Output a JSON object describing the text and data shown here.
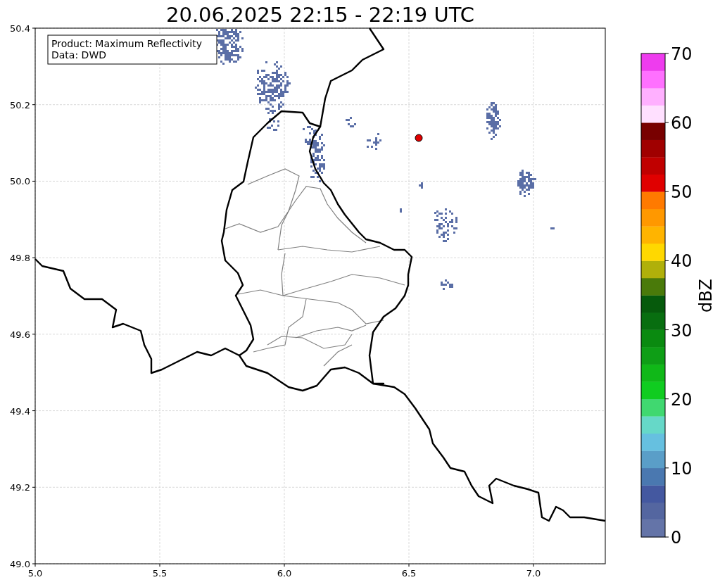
{
  "title": "20.06.2025 22:15 - 22:19 UTC",
  "info_box": [
    "Product: Maximum Reflectivity",
    "Data: DWD"
  ],
  "x_axis": {
    "ticks": [
      "5.0",
      "5.5",
      "6.0",
      "6.5",
      "7.0"
    ]
  },
  "y_axis": {
    "ticks": [
      "50.4",
      "50.2",
      "50.0",
      "49.8",
      "49.6",
      "49.4",
      "49.2",
      "49.0"
    ]
  },
  "colorbar": {
    "label": "dBZ",
    "ticks": [
      "70",
      "60",
      "50",
      "40",
      "30",
      "20",
      "10",
      "0"
    ],
    "bands": [
      {
        "color": "#6474a8"
      },
      {
        "color": "#5466a0"
      },
      {
        "color": "#4458a0"
      },
      {
        "color": "#4a78b0"
      },
      {
        "color": "#5a9ec8"
      },
      {
        "color": "#66c0e0"
      },
      {
        "color": "#66d8c8"
      },
      {
        "color": "#40d870"
      },
      {
        "color": "#10cc20"
      },
      {
        "color": "#10b818"
      },
      {
        "color": "#0e9e16"
      },
      {
        "color": "#0a8a10"
      },
      {
        "color": "#086e10"
      },
      {
        "color": "#065a0c"
      },
      {
        "color": "#4a7a0a"
      },
      {
        "color": "#b0b00a"
      },
      {
        "color": "#ffd800"
      },
      {
        "color": "#ffb400"
      },
      {
        "color": "#ff9800"
      },
      {
        "color": "#ff7a00"
      },
      {
        "color": "#e00000"
      },
      {
        "color": "#c00000"
      },
      {
        "color": "#a00000"
      },
      {
        "color": "#780000"
      },
      {
        "color": "#ffe0ff"
      },
      {
        "color": "#ffb0ff"
      },
      {
        "color": "#ff70ff"
      },
      {
        "color": "#ee3cee"
      }
    ]
  }
}
